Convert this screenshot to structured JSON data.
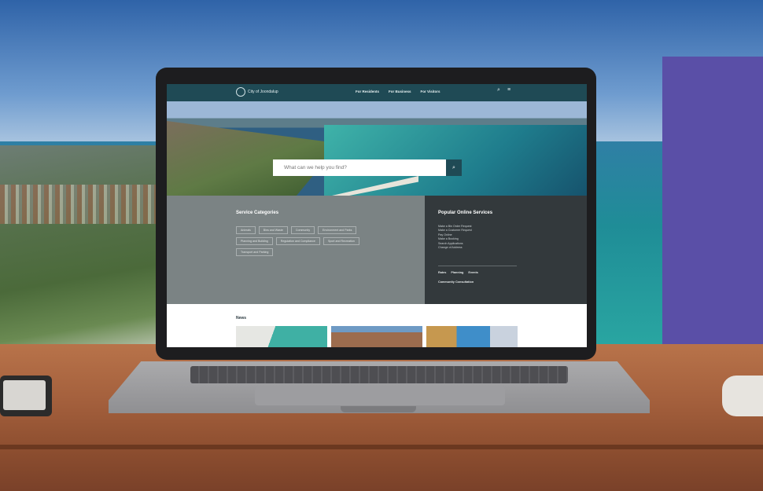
{
  "colors": {
    "accent": "#1f4a55",
    "category_panel": "#7b8384",
    "services_panel": "#33393c",
    "purple_block": "#5a4fa7"
  },
  "website": {
    "logo": {
      "text": "City of Joondalup",
      "icon": "city-logo-icon"
    },
    "nav": {
      "links": [
        "For Residents",
        "For Business",
        "For Visitors"
      ],
      "icons": [
        "search-icon",
        "menu-icon"
      ]
    },
    "search": {
      "placeholder": "What can we help you find?",
      "button_icon": "search-icon"
    },
    "service_categories": {
      "title": "Service Categories",
      "chips": [
        "Animals",
        "Bins and Waste",
        "Community",
        "Environment and Parks",
        "Planning and Building",
        "Regulation and Compliance",
        "Sport and Recreation",
        "Transport and Parking"
      ]
    },
    "popular_services": {
      "title": "Popular Online Services",
      "items": [
        "Make a Bin Order Request",
        "Make a Customer Request",
        "Pay Online",
        "Make a Booking",
        "Search Applications",
        "Change of Address"
      ],
      "links": [
        "Rates",
        "Planning",
        "Events"
      ],
      "extra_link": "Community Consultation"
    },
    "news": {
      "title": "News"
    }
  }
}
